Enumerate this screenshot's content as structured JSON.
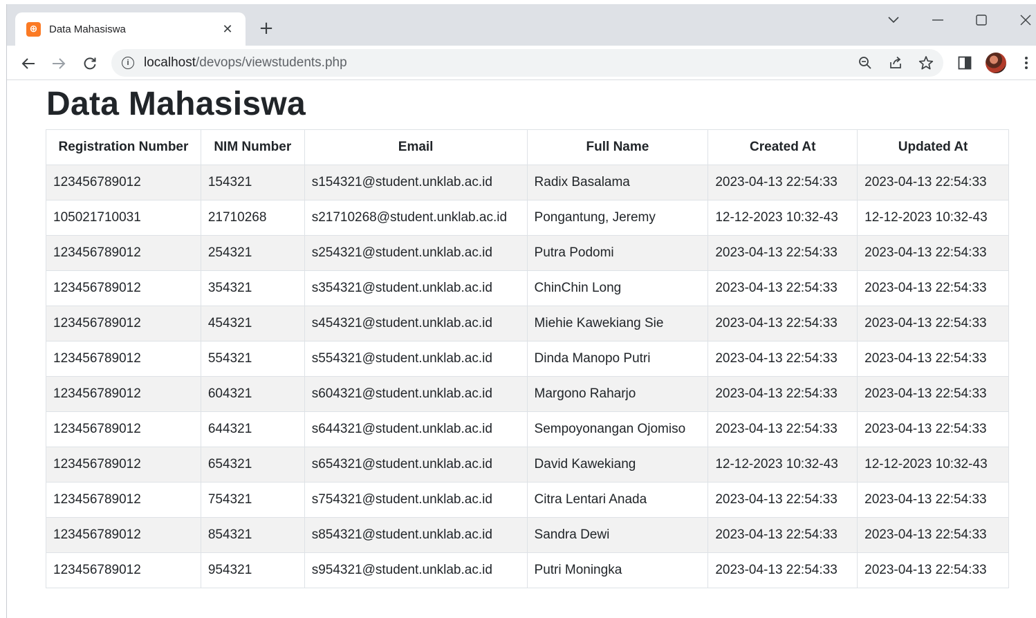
{
  "browser": {
    "tab_title": "Data Mahasiswa",
    "tab_close": "✕",
    "new_tab": "+",
    "url_host": "localhost",
    "url_path": "/devops/viewstudents.php"
  },
  "page": {
    "title": "Data Mahasiswa"
  },
  "table": {
    "headers": [
      "Registration Number",
      "NIM Number",
      "Email",
      "Full Name",
      "Created At",
      "Updated At"
    ],
    "rows": [
      [
        "123456789012",
        "154321",
        "s154321@student.unklab.ac.id",
        "Radix Basalama",
        "2023-04-13 22:54:33",
        "2023-04-13 22:54:33"
      ],
      [
        "105021710031",
        "21710268",
        "s21710268@student.unklab.ac.id",
        "Pongantung, Jeremy",
        "12-12-2023 10:32-43",
        "12-12-2023 10:32-43"
      ],
      [
        "123456789012",
        "254321",
        "s254321@student.unklab.ac.id",
        "Putra Podomi",
        "2023-04-13 22:54:33",
        "2023-04-13 22:54:33"
      ],
      [
        "123456789012",
        "354321",
        "s354321@student.unklab.ac.id",
        "ChinChin Long",
        "2023-04-13 22:54:33",
        "2023-04-13 22:54:33"
      ],
      [
        "123456789012",
        "454321",
        "s454321@student.unklab.ac.id",
        "Miehie Kawekiang Sie",
        "2023-04-13 22:54:33",
        "2023-04-13 22:54:33"
      ],
      [
        "123456789012",
        "554321",
        "s554321@student.unklab.ac.id",
        "Dinda Manopo Putri",
        "2023-04-13 22:54:33",
        "2023-04-13 22:54:33"
      ],
      [
        "123456789012",
        "604321",
        "s604321@student.unklab.ac.id",
        "Margono Raharjo",
        "2023-04-13 22:54:33",
        "2023-04-13 22:54:33"
      ],
      [
        "123456789012",
        "644321",
        "s644321@student.unklab.ac.id",
        "Sempoyonangan Ojomiso",
        "2023-04-13 22:54:33",
        "2023-04-13 22:54:33"
      ],
      [
        "123456789012",
        "654321",
        "s654321@student.unklab.ac.id",
        "David Kawekiang",
        "12-12-2023 10:32-43",
        "12-12-2023 10:32-43"
      ],
      [
        "123456789012",
        "754321",
        "s754321@student.unklab.ac.id",
        "Citra Lentari Anada",
        "2023-04-13 22:54:33",
        "2023-04-13 22:54:33"
      ],
      [
        "123456789012",
        "854321",
        "s854321@student.unklab.ac.id",
        "Sandra Dewi",
        "2023-04-13 22:54:33",
        "2023-04-13 22:54:33"
      ],
      [
        "123456789012",
        "954321",
        "s954321@student.unklab.ac.id",
        "Putri Moningka",
        "2023-04-13 22:54:33",
        "2023-04-13 22:54:33"
      ]
    ]
  }
}
